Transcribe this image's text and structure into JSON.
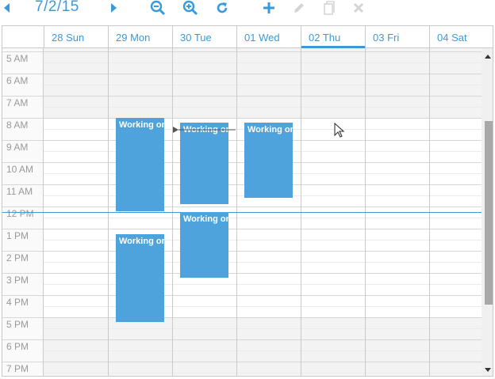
{
  "toolbar": {
    "current_date": "7/2/15",
    "icons": [
      "prev-arrow-icon",
      "next-arrow-icon",
      "zoom-out-icon",
      "zoom-in-icon",
      "refresh-icon",
      "add-icon",
      "edit-icon",
      "copy-icon",
      "delete-icon"
    ]
  },
  "days": [
    {
      "label": "28 Sun"
    },
    {
      "label": "29 Mon"
    },
    {
      "label": "30 Tue"
    },
    {
      "label": "01 Wed"
    },
    {
      "label": "02 Thu",
      "today": true
    },
    {
      "label": "03 Fri"
    },
    {
      "label": "04 Sat"
    }
  ],
  "hours": [
    "5 AM",
    "6 AM",
    "7 AM",
    "8 AM",
    "9 AM",
    "10 AM",
    "11 AM",
    "12 PM",
    "1 PM",
    "2 PM",
    "3 PM",
    "4 PM",
    "5 PM",
    "6 PM",
    "7 PM"
  ],
  "events": [
    {
      "day": 1,
      "start": 8.0,
      "end": 12.2,
      "title": "Working on"
    },
    {
      "day": 1,
      "start": 13.25,
      "end": 17.2,
      "title": "Working on"
    },
    {
      "day": 2,
      "start": 8.2,
      "end": 11.9,
      "title": "Working on"
    },
    {
      "day": 2,
      "start": 12.25,
      "end": 15.2,
      "title": "Working on"
    },
    {
      "day": 3,
      "start": 8.2,
      "end": 11.6,
      "title": "Working on"
    }
  ],
  "now_time": 11.75,
  "colors": {
    "accent": "#3a9ad9",
    "event": "#4fa3dd"
  }
}
